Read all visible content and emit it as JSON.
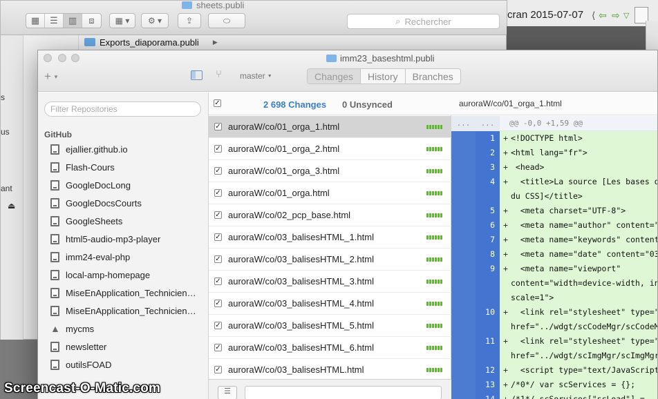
{
  "finder": {
    "title": "sheets.publi",
    "search_placeholder": "Rechercher",
    "row_label": "Exports_diaporama.publi",
    "side_fragments": [
      "s",
      "us",
      "ant"
    ]
  },
  "preview": {
    "title": "cran 2015-07-07"
  },
  "app": {
    "window_title": "imm23_baseshtml.publi",
    "branch": "master",
    "tabs": [
      "Changes",
      "History",
      "Branches"
    ]
  },
  "sidebar": {
    "filter_placeholder": "Filter Repositories",
    "group": "GitHub",
    "repos": [
      {
        "name": "ejallier.github.io",
        "icon": "repo-icon"
      },
      {
        "name": "Flash-Cours",
        "icon": "repo-icon"
      },
      {
        "name": "GoogleDocLong",
        "icon": "repo-icon"
      },
      {
        "name": "GoogleDocsCourts",
        "icon": "repo-icon"
      },
      {
        "name": "GoogleSheets",
        "icon": "repo-icon"
      },
      {
        "name": "html5-audio-mp3-player",
        "icon": "repo-icon"
      },
      {
        "name": "imm24-eval-php",
        "icon": "repo-icon"
      },
      {
        "name": "local-amp-homepage",
        "icon": "repo-icon"
      },
      {
        "name": "MiseEnApplication_Technicien…",
        "icon": "repo-icon"
      },
      {
        "name": "MiseEnApplication_Technicien…",
        "icon": "repo-icon"
      },
      {
        "name": "mycms",
        "icon": "warning-icon"
      },
      {
        "name": "newsletter",
        "icon": "repo-icon"
      },
      {
        "name": "outilsFOAD",
        "icon": "repo-icon"
      }
    ]
  },
  "changes": {
    "count_label": "2 698 Changes",
    "unsynced_label": "0 Unsynced",
    "files": [
      "auroraW/co/01_orga_1.html",
      "auroraW/co/01_orga_2.html",
      "auroraW/co/01_orga_3.html",
      "auroraW/co/01_orga.html",
      "auroraW/co/02_pcp_base.html",
      "auroraW/co/03_balisesHTML_1.html",
      "auroraW/co/03_balisesHTML_2.html",
      "auroraW/co/03_balisesHTML_3.html",
      "auroraW/co/03_balisesHTML_4.html",
      "auroraW/co/03_balisesHTML_5.html",
      "auroraW/co/03_balisesHTML_6.html",
      "auroraW/co/03_balisesHTML.html"
    ]
  },
  "diff": {
    "file_path": "auroraW/co/01_orga_1.html",
    "hunk_dots": "...",
    "hunk_header": "@@ -0,0 +1,59 @@",
    "lines": [
      {
        "no": "1",
        "code": "<!DOCTYPE html>",
        "cont": ""
      },
      {
        "no": "2",
        "code": "<html lang=\"fr\">",
        "cont": ""
      },
      {
        "no": "3",
        "code": " <head>",
        "cont": ""
      },
      {
        "no": "4",
        "code": "  <title>La source [Les bases d",
        "cont": "du CSS]</title>"
      },
      {
        "no": "5",
        "code": "  <meta charset=\"UTF-8\">",
        "cont": ""
      },
      {
        "no": "6",
        "code": "  <meta name=\"author\" content=\"",
        "cont": ""
      },
      {
        "no": "7",
        "code": "  <meta name=\"keywords\" content",
        "cont": ""
      },
      {
        "no": "8",
        "code": "  <meta name=\"date\" content=\"03",
        "cont": ""
      },
      {
        "no": "9",
        "code": "  <meta name=\"viewport\"",
        "cont": "content=\"width=device-width, in",
        "cont2": "scale=1\">"
      },
      {
        "no": "10",
        "code": "  <link rel=\"stylesheet\" type=\"",
        "cont": "href=\"../wdgt/scCodeMgr/scCodeM"
      },
      {
        "no": "11",
        "code": "  <link rel=\"stylesheet\" type=\"",
        "cont": "href=\"../wdgt/scImgMgr/scImgMgr"
      },
      {
        "no": "12",
        "code": "  <script type=\"text/JavaScript",
        "cont": ""
      },
      {
        "no": "13",
        "code": "/*0*/ var scServices = {};",
        "cont": ""
      },
      {
        "no": "14",
        "code": "/*1*/ scServices[\"scLoad\"] =",
        "cont": ""
      }
    ]
  },
  "watermark": "Screencast-O-Matic.com"
}
